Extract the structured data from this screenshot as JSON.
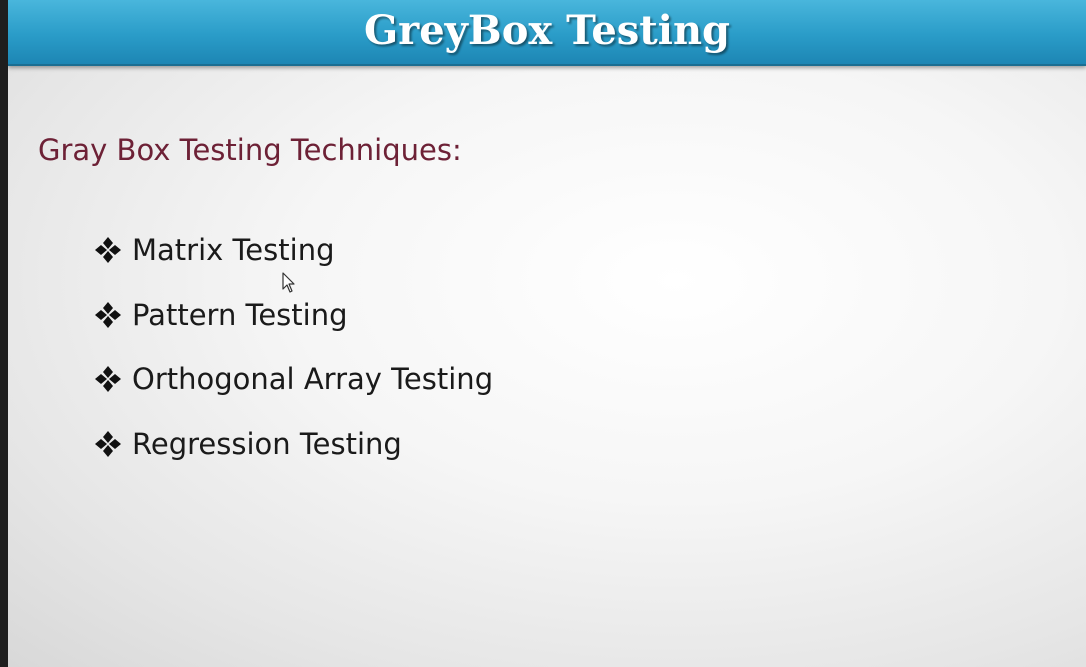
{
  "slide": {
    "title": "GreyBox Testing",
    "subtitle": "Gray Box Testing Techniques:",
    "bullets": [
      {
        "label": "Matrix Testing"
      },
      {
        "label": "Pattern Testing"
      },
      {
        "label": "Orthogonal Array Testing"
      },
      {
        "label": "Regression Testing"
      }
    ]
  },
  "colors": {
    "title_bar": "#2a9cc8",
    "title_text": "#ffffff",
    "subtitle_text": "#6d2136",
    "bullet_text": "#1a1a1a"
  },
  "icons": {
    "bullet": "four-diamond-bullet-icon",
    "pointer": "mouse-pointer-icon"
  }
}
